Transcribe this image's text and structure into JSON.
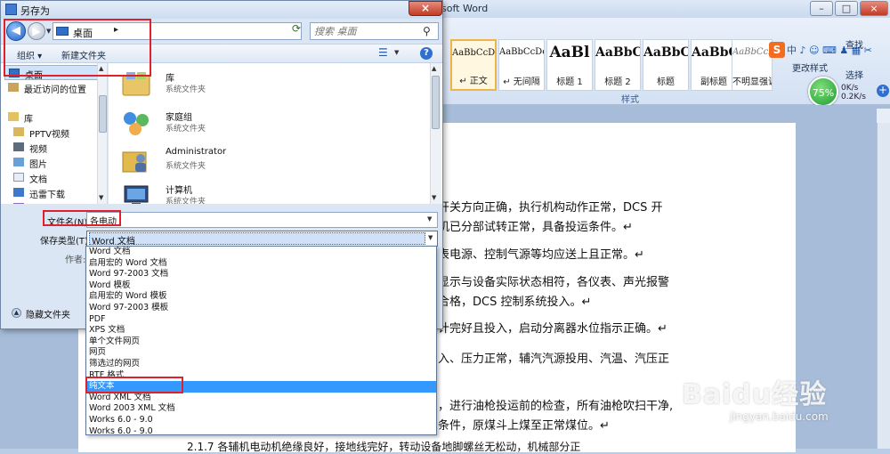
{
  "word": {
    "title": "rosoft Word",
    "window_controls": [
      "–",
      "□",
      "×"
    ],
    "styles": [
      {
        "sample": "AaBbCcDc",
        "name": "↵ 正文"
      },
      {
        "sample": "AaBbCcDc",
        "name": "↵ 无间隔"
      },
      {
        "sample": "AaBl",
        "name": "标题 1"
      },
      {
        "sample": "AaBbC",
        "name": "标题 2"
      },
      {
        "sample": "AaBbC",
        "name": "标题"
      },
      {
        "sample": "AaBbC",
        "name": "副标题"
      },
      {
        "sample": "AaBbCcDc",
        "name": "不明显强调"
      }
    ],
    "styles_group_label": "样式",
    "change_styles_label": "更改样式",
    "find_label": "查找",
    "select_label": "选择",
    "ime_bar_text": "中 ♪ ☺ ⌨ ♟ ▦ ✂",
    "sogou_badge": "S",
    "speed": {
      "percent": "75%",
      "up": "0K/s",
      "down": "0.2K/s",
      "plus": "+"
    },
    "doc_lines": [
      "开关方向正确，执行机构动作正常，DCS 开",
      "机已分部试转正常，具备投运条件。↵",
      "表电源、控制气源等均应送上且正常。↵",
      "显示与设备实际状态相符，各仪表、声光报警",
      "合格，DCS 控制系统投入。↵",
      "计完好且投入，启动分离器水位指示正确。↵",
      "入、压力正常，辅汽汽源投用、汽温、汽压正",
      "，进行油枪投运前的检查，所有油枪吹扫干净,",
      "条件，原煤斗上煤至正常煤位。↵"
    ],
    "bottom_line": "2.1.7 各辅机电动机绝缘良好，接地线完好，转动设备地脚螺丝无松动，机械部分正",
    "watermark": "Baidu经验",
    "watermark_sub": "jingyan.baidu.com"
  },
  "dialog": {
    "title": "另存为",
    "close_label": "×",
    "address": {
      "location": "桌面",
      "chevron": "▸"
    },
    "search_placeholder": "搜索 桌面",
    "toolbar": {
      "organize": "组织 ▾",
      "new_folder": "新建文件夹",
      "help": "?"
    },
    "nav_items": [
      {
        "label": "桌面",
        "selected": true
      },
      {
        "label": "最近访问的位置",
        "selected": false
      },
      {
        "label": "库",
        "selected": false
      },
      {
        "label": "PPTV视频",
        "selected": false
      },
      {
        "label": "视频",
        "selected": false
      },
      {
        "label": "图片",
        "selected": false
      },
      {
        "label": "文档",
        "selected": false
      },
      {
        "label": "迅雷下载",
        "selected": false
      },
      {
        "label": "音乐",
        "selected": false
      }
    ],
    "files": [
      {
        "name": "库",
        "type": "系统文件夹",
        "icon": "library-icon"
      },
      {
        "name": "家庭组",
        "type": "系统文件夹",
        "icon": "homegroup-icon"
      },
      {
        "name": "Administrator",
        "type": "系统文件夹",
        "icon": "user-folder-icon"
      },
      {
        "name": "计算机",
        "type": "系统文件夹",
        "icon": "computer-icon"
      }
    ],
    "filename_label": "文件名(N):",
    "filename_value": "各电动",
    "savetype_label": "保存类型(T):",
    "savetype_value": "Word 文档",
    "author_label": "作者:",
    "hide_folders_label": "隐藏文件夹",
    "type_options": [
      "Word 文档",
      "启用宏的 Word 文档",
      "Word 97-2003 文档",
      "Word 模板",
      "启用宏的 Word 模板",
      "Word 97-2003 模板",
      "PDF",
      "XPS 文档",
      "单个文件网页",
      "网页",
      "筛选过的网页",
      "RTF 格式",
      "纯文本",
      "Word XML 文档",
      "Word 2003 XML 文档",
      "Works 6.0 - 9.0",
      "Works 6.0 - 9.0"
    ],
    "highlighted_option": "纯文本"
  },
  "colors": {
    "annotation_red": "#e0202a",
    "highlight_blue": "#3399ff"
  }
}
